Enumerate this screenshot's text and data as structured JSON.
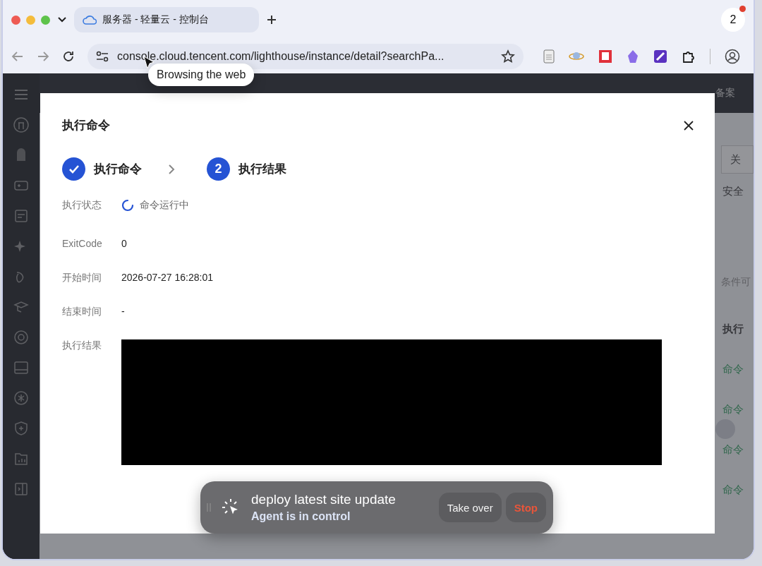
{
  "browser": {
    "tab_title": "服务器 - 轻量云 - 控制台",
    "url": "console.cloud.tencent.com/lighthouse/instance/detail?searchPa...",
    "profile_count": "2",
    "tooltip": "Browsing the web"
  },
  "background": {
    "header_link": "备案",
    "side_texts": [
      {
        "text": "关",
        "kind": "button"
      },
      {
        "text": "安全",
        "kind": "text"
      },
      {
        "text": "条件可",
        "kind": "hint"
      },
      {
        "text": "执行",
        "kind": "heading"
      },
      {
        "text": "命令",
        "kind": "status"
      },
      {
        "text": "命令",
        "kind": "status"
      },
      {
        "text": "命令",
        "kind": "status"
      },
      {
        "text": "命令",
        "kind": "status"
      }
    ]
  },
  "modal": {
    "title": "执行命令",
    "steps": [
      {
        "label": "执行命令",
        "done": true
      },
      {
        "number": "2",
        "label": "执行结果",
        "done": false
      }
    ],
    "fields": [
      {
        "label": "执行状态",
        "value": "命令运行中",
        "kind": "running"
      },
      {
        "label": "ExitCode",
        "value": "0",
        "kind": "text"
      },
      {
        "label": "开始时间",
        "value": "2026-07-27 16:28:01",
        "kind": "text"
      },
      {
        "label": "结束时间",
        "value": "-",
        "kind": "text"
      },
      {
        "label": "执行结果",
        "kind": "output"
      }
    ]
  },
  "agent": {
    "task": "deploy latest site update",
    "status": "Agent is in control",
    "buttons": [
      {
        "label": "Take over",
        "kind": "neutral"
      },
      {
        "label": "Stop",
        "kind": "danger"
      }
    ]
  }
}
